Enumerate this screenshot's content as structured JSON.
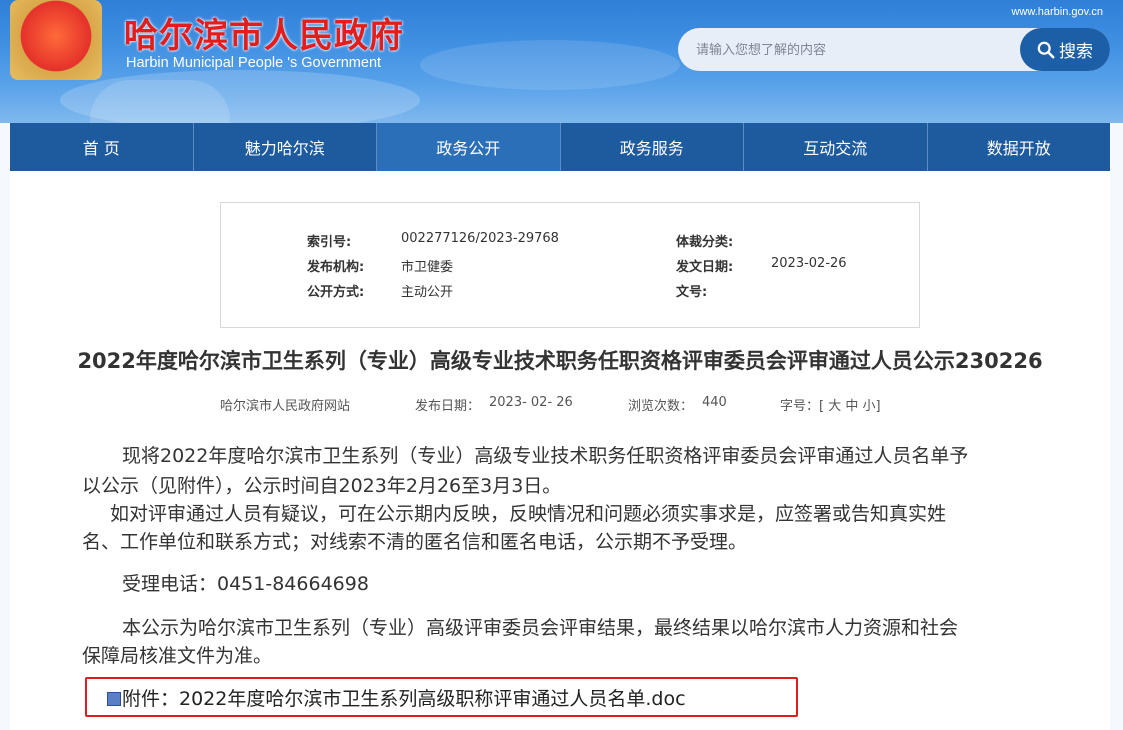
{
  "header": {
    "site_title": "哈尔滨市人民政府",
    "site_subtitle": "Harbin Municipal People 's Government",
    "domain": "www.harbin.gov.cn",
    "search_placeholder": "请输入您想了解的内容",
    "search_button": "搜索"
  },
  "nav": {
    "items": [
      "首 页",
      "魅力哈尔滨",
      "政务公开",
      "政务服务",
      "互动交流",
      "数据开放"
    ],
    "active_index": 2
  },
  "meta": {
    "index_label": "索引号:",
    "index_value": "002277126/2023-29768",
    "genre_label": "体裁分类:",
    "genre_value": "",
    "org_label": "发布机构:",
    "org_value": "市卫健委",
    "date_label": "发文日期:",
    "date_value": "2023-02-26",
    "open_label": "公开方式:",
    "open_value": "主动公开",
    "docno_label": "文号:",
    "docno_value": ""
  },
  "article": {
    "title": "2022年度哈尔滨市卫生系列（专业）高级专业技术职务任职资格评审委员会评审通过人员公示230226",
    "source": "哈尔滨市人民政府网站",
    "pub_label": "发布日期：",
    "pub_value": "2023- 02- 26",
    "views_label": "浏览次数：",
    "views_value": "440",
    "fontsize_label": "字号：[ 大 中 小]",
    "p1_line1": "现将2022年度哈尔滨市卫生系列（专业）高级专业技术职务任职资格评审委员会评审通过人员名单予",
    "p1_line2": "以公示（见附件），公示时间自2023年2月26至3月3日。",
    "p2_line1": "如对评审通过人员有疑议，可在公示期内反映，反映情况和问题必须实事求是，应签署或告知真实姓",
    "p2_line2": "名、工作单位和联系方式；对线索不清的匿名信和匿名电话，公示期不予受理。",
    "phone": "受理电话：0451-84664698",
    "p4_line1": "本公示为哈尔滨市卫生系列（专业）高级评审委员会评审结果，最终结果以哈尔滨市人力资源和社会",
    "p4_line2": "保障局核准文件为准。",
    "attachment": "附件：2022年度哈尔滨市卫生系列高级职称评审通过人员名单.doc"
  },
  "colors": {
    "nav_bg": "#1d5a9e",
    "nav_active": "#2a6fb7",
    "title_red": "#e31c1c",
    "highlight_border": "#e01b1b"
  }
}
